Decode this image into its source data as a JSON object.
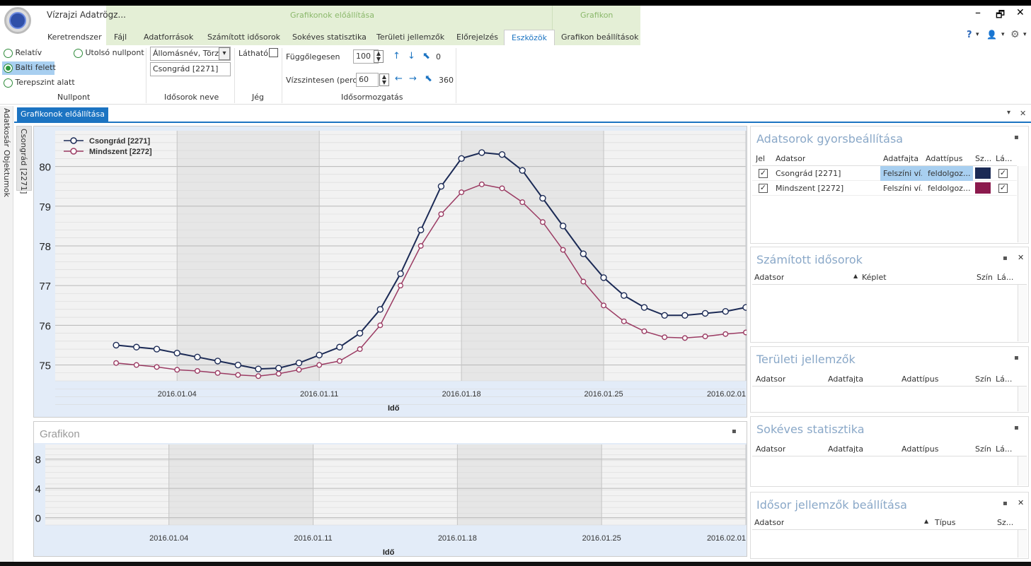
{
  "app": {
    "title": "Vízrajzi Adatrögz..."
  },
  "context_groups": {
    "chart_group": "Grafikonok előállítása",
    "graph_group": "Grafikon"
  },
  "tabs": [
    {
      "label": "Keretrendszer"
    },
    {
      "label": "Fájl"
    },
    {
      "label": "Adatforrások"
    },
    {
      "label": "Számított idősorok"
    },
    {
      "label": "Sokéves statisztika"
    },
    {
      "label": "Területi jellemzők"
    },
    {
      "label": "Előrejelzés"
    },
    {
      "label": "Eszközök"
    },
    {
      "label": "Grafikon beállítások"
    }
  ],
  "window": {
    "minimize": "–",
    "restore": "🗗",
    "close": "✕"
  },
  "right_icons": {
    "help": "?",
    "user": "👤",
    "settings": "⚙",
    "dropdown": "▾"
  },
  "ribbon": {
    "nullpont": {
      "group_label": "Nullpont",
      "options": [
        {
          "label": "Relatív",
          "selected": false
        },
        {
          "label": "Balti felett",
          "selected": true
        },
        {
          "label": "Terepszint alatt",
          "selected": false
        },
        {
          "label": "Utolsó nullpont",
          "selected": false
        }
      ]
    },
    "idosorok": {
      "group_label": "Idősorok neve",
      "select_value": "Állomásnév, Törzs",
      "list_value": "Csongrád [2271]"
    },
    "jeg": {
      "group_label": "Jég",
      "visible_label": "Látható",
      "checked": false
    },
    "mozgatas": {
      "group_label": "Idősormozgatás",
      "vertical_label": "Függőlegesen",
      "vertical_value": "100",
      "vertical_offset": "0",
      "horizontal_label": "Vízszintesen (perc)",
      "horizontal_value": "60",
      "horizontal_offset": "360"
    }
  },
  "doc": {
    "tab_label": "Grafikonok előállítása",
    "menu_icon": "▾",
    "close_icon": "✕"
  },
  "side_tabs": {
    "adatkosar": "Adatkosár",
    "objektumok": "Objektumok",
    "csongrad": "Csongrád [2271]"
  },
  "chart_data": [
    {
      "type": "line",
      "title": "",
      "xlabel": "Idő",
      "ylabel": "",
      "x_tick_labels": [
        "2016.01.04",
        "2016.01.11",
        "2016.01.18",
        "2016.01.25",
        "2016.02.01"
      ],
      "y_tick_labels": [
        "75",
        "76",
        "77",
        "78",
        "79",
        "80"
      ],
      "ylim": [
        74.6,
        80.9
      ],
      "legend_position": "top-left",
      "series": [
        {
          "name": "Csongrád [2271]",
          "color": "#1b2a55",
          "x": [
            "2016.01.01",
            "2016.01.02",
            "2016.01.03",
            "2016.01.04",
            "2016.01.05",
            "2016.01.06",
            "2016.01.07",
            "2016.01.08",
            "2016.01.09",
            "2016.01.10",
            "2016.01.11",
            "2016.01.12",
            "2016.01.13",
            "2016.01.14",
            "2016.01.15",
            "2016.01.16",
            "2016.01.17",
            "2016.01.18",
            "2016.01.19",
            "2016.01.20",
            "2016.01.21",
            "2016.01.22",
            "2016.01.23",
            "2016.01.24",
            "2016.01.25",
            "2016.01.26",
            "2016.01.27",
            "2016.01.28",
            "2016.01.29",
            "2016.01.30",
            "2016.01.31",
            "2016.02.01"
          ],
          "values": [
            75.5,
            75.45,
            75.4,
            75.3,
            75.2,
            75.1,
            75.0,
            74.9,
            74.92,
            75.05,
            75.25,
            75.45,
            75.8,
            76.4,
            77.3,
            78.4,
            79.5,
            80.2,
            80.35,
            80.3,
            79.9,
            79.2,
            78.5,
            77.8,
            77.2,
            76.75,
            76.45,
            76.25,
            76.25,
            76.3,
            76.35,
            76.45
          ]
        },
        {
          "name": "Mindszent [2272]",
          "color": "#9b3b63",
          "x": [
            "2016.01.01",
            "2016.01.02",
            "2016.01.03",
            "2016.01.04",
            "2016.01.05",
            "2016.01.06",
            "2016.01.07",
            "2016.01.08",
            "2016.01.09",
            "2016.01.10",
            "2016.01.11",
            "2016.01.12",
            "2016.01.13",
            "2016.01.14",
            "2016.01.15",
            "2016.01.16",
            "2016.01.17",
            "2016.01.18",
            "2016.01.19",
            "2016.01.20",
            "2016.01.21",
            "2016.01.22",
            "2016.01.23",
            "2016.01.24",
            "2016.01.25",
            "2016.01.26",
            "2016.01.27",
            "2016.01.28",
            "2016.01.29",
            "2016.01.30",
            "2016.01.31",
            "2016.02.01"
          ],
          "values": [
            75.05,
            75.0,
            74.95,
            74.88,
            74.85,
            74.8,
            74.75,
            74.72,
            74.78,
            74.88,
            75.0,
            75.1,
            75.4,
            76.0,
            77.0,
            78.0,
            78.8,
            79.35,
            79.55,
            79.45,
            79.1,
            78.6,
            77.9,
            77.1,
            76.5,
            76.1,
            75.85,
            75.7,
            75.68,
            75.72,
            75.78,
            75.82
          ]
        }
      ]
    },
    {
      "type": "line",
      "title": "Grafikon",
      "xlabel": "Idő",
      "ylabel": "",
      "x_tick_labels": [
        "2016.01.04",
        "2016.01.11",
        "2016.01.18",
        "2016.01.25",
        "2016.02.01"
      ],
      "y_tick_labels": [
        "0",
        "4",
        "8"
      ],
      "ylim": [
        -1,
        10
      ],
      "series": []
    }
  ],
  "panels": {
    "gyors": {
      "title": "Adatsorok gyorsbeállítása",
      "columns": [
        "Jel",
        "Adatsor",
        "Adatfajta",
        "Adattípus",
        "Sz...",
        "Lá..."
      ],
      "rows": [
        {
          "adatsor": "Csongrád [2271]",
          "adatfajta": "Felszíni ví...",
          "adattipus": "feldolgoz...",
          "color": "#1b2a55",
          "jel": true,
          "lathato": true
        },
        {
          "adatsor": "Mindszent [2272]",
          "adatfajta": "Felszíni ví...",
          "adattipus": "feldolgoz...",
          "color": "#8b1a4d",
          "jel": true,
          "lathato": true
        }
      ]
    },
    "szamitott": {
      "title": "Számított idősorok",
      "columns": [
        "Adatsor",
        "Képlet",
        "Szín",
        "Lá..."
      ]
    },
    "teruleti": {
      "title": "Területi jellemzők",
      "columns": [
        "Adatsor",
        "Adatfajta",
        "Adattípus",
        "Szín",
        "Lá..."
      ]
    },
    "sokeves": {
      "title": "Sokéves statisztika",
      "columns": [
        "Adatsor",
        "Adatfajta",
        "Adattípus",
        "Szín",
        "Lá..."
      ]
    },
    "idosor_jell": {
      "title": "Idősor jellemzők beállítása",
      "columns": [
        "Adatsor",
        "Típus",
        "Sz..."
      ]
    }
  }
}
